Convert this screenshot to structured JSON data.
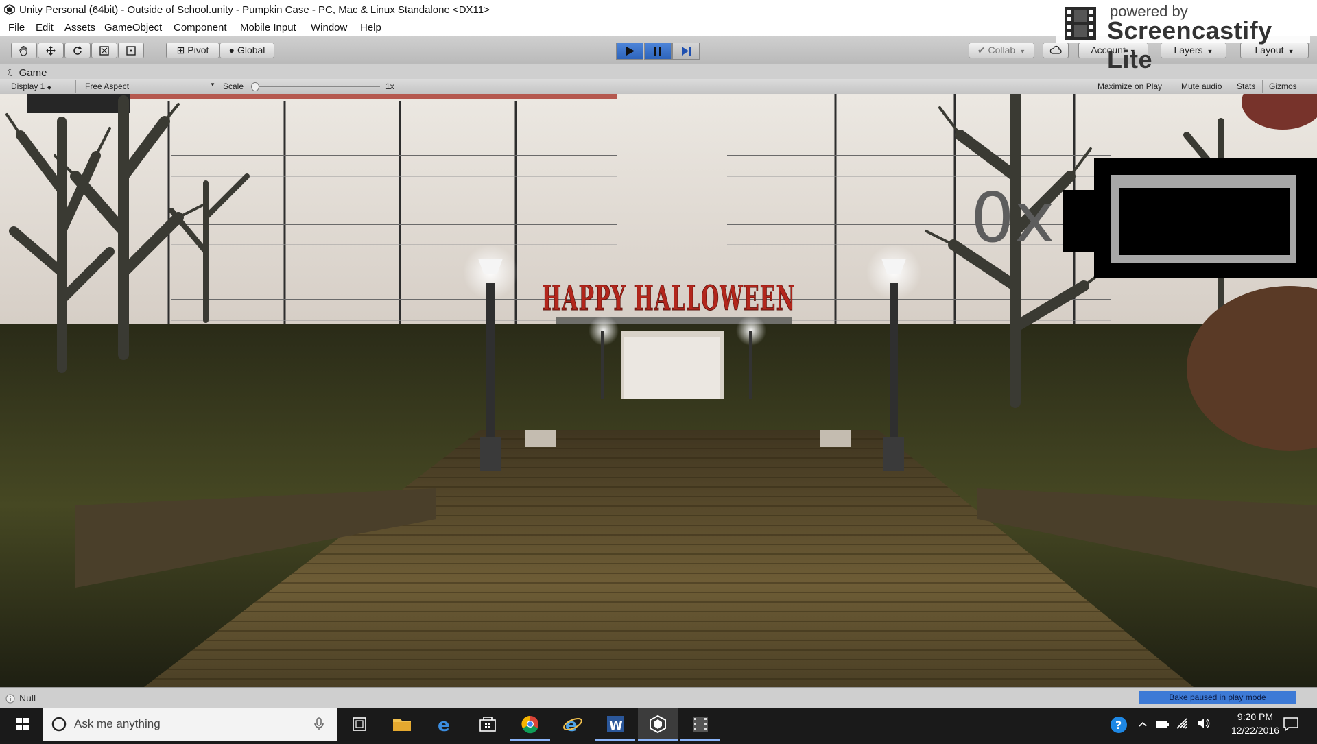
{
  "window": {
    "title": "Unity Personal (64bit) - Outside of School.unity - Pumpkin Case - PC, Mac & Linux Standalone <DX11>"
  },
  "menu": [
    "File",
    "Edit",
    "Assets",
    "GameObject",
    "Component",
    "Mobile Input",
    "Window",
    "Help"
  ],
  "watermark": {
    "line1": "powered by",
    "line2": "Screencastify Lite"
  },
  "toolbar": {
    "pivot_label": "Pivot",
    "global_label": "Global",
    "collab_label": "Collab",
    "account_label": "Account",
    "layers_label": "Layers",
    "layout_label": "Layout",
    "play_active": true
  },
  "game_tab": {
    "title": "Game",
    "display": "Display 1",
    "aspect": "Free Aspect",
    "scale_label": "Scale",
    "scale_value": "1x",
    "maximize_on_play": "Maximize on Play",
    "mute_audio": "Mute audio",
    "stats": "Stats",
    "gizmos": "Gizmos"
  },
  "scene": {
    "sign_text": "HAPPY HALLOWEEN",
    "hud_text": "0x"
  },
  "status": {
    "message": "Null",
    "badge": "Bake paused in play mode"
  },
  "taskbar": {
    "search_placeholder": "Ask me anything",
    "time": "9:20 PM",
    "date": "12/22/2016"
  },
  "colors": {
    "sky_wall": "#e7e2dc",
    "sign_red": "#b2261c",
    "grass": "#3a3c1f",
    "path": "#6b5a33",
    "play_blue": "#3a75cf"
  }
}
